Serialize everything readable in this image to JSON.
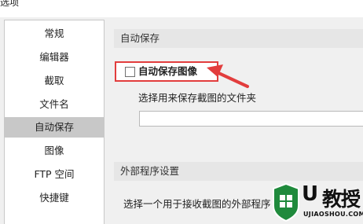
{
  "window": {
    "title": "选项"
  },
  "sidebar": {
    "items": [
      {
        "label": "常规"
      },
      {
        "label": "编辑器"
      },
      {
        "label": "截取"
      },
      {
        "label": "文件名"
      },
      {
        "label": "自动保存",
        "active": true
      },
      {
        "label": "图像"
      },
      {
        "label": "FTP 空间"
      },
      {
        "label": "快捷键"
      }
    ]
  },
  "autosave": {
    "section_title": "自动保存",
    "checkbox_label": "自动保存图像",
    "checkbox_checked": false,
    "folder_label": "选择用来保存截图的文件夹",
    "folder_value": ""
  },
  "external": {
    "section_title": "外部程序设置",
    "label": "选择一个用于接收截图的外部程序"
  },
  "watermark": {
    "u": "U",
    "brand": "教授",
    "url": "UJIAOSHOU.COM"
  },
  "colors": {
    "highlight": "#e23d3d",
    "watermark_green": "#1f8a3c"
  }
}
